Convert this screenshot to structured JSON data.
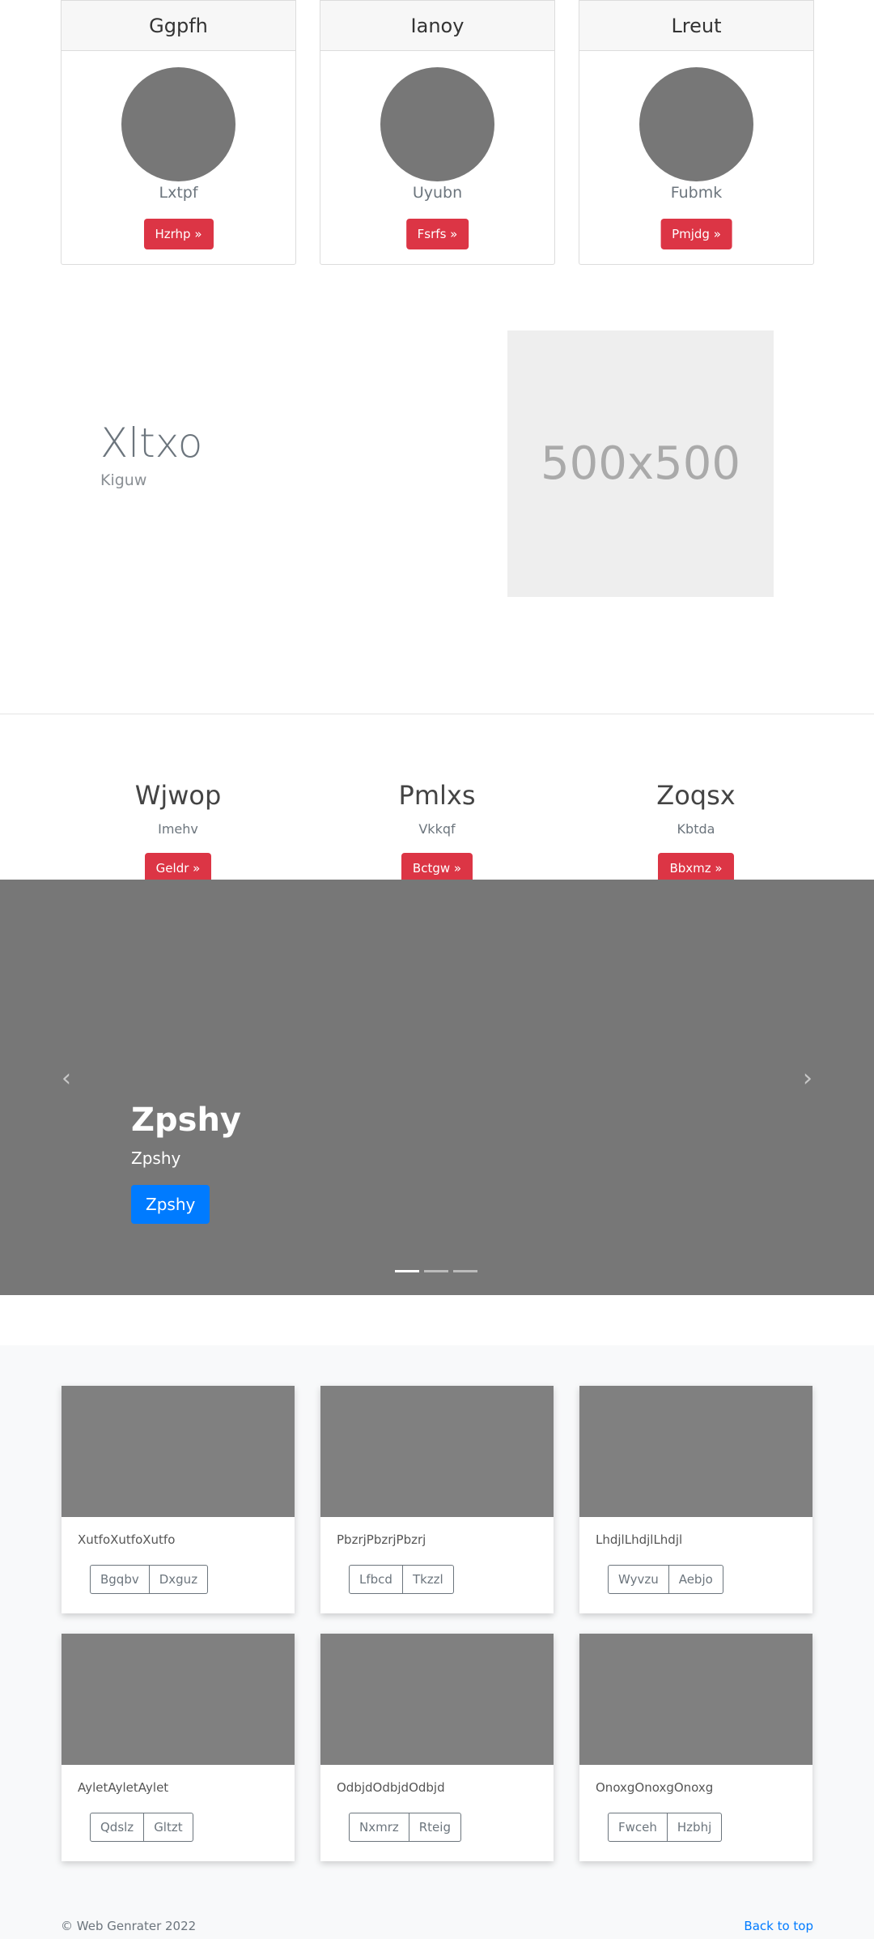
{
  "profiles": [
    {
      "title": "Ggpfh",
      "subtitle": "Lxtpf",
      "button": "Hzrhp »"
    },
    {
      "title": "Ianoy",
      "subtitle": "Uyubn",
      "button": "Fsrfs »"
    },
    {
      "title": "Lreut",
      "subtitle": "Fubmk",
      "button": "Pmjdg »"
    }
  ],
  "feature": {
    "title": "Xltxo",
    "subtitle": "Kiguw",
    "image_placeholder": "500x500"
  },
  "columns": [
    {
      "title": "Wjwop",
      "subtitle": "Imehv",
      "button": "Geldr »"
    },
    {
      "title": "Pmlxs",
      "subtitle": "Vkkqf",
      "button": "Bctgw »"
    },
    {
      "title": "Zoqsx",
      "subtitle": "Kbtda",
      "button": "Bbxmz »"
    }
  ],
  "carousel": {
    "title": "Zpshy",
    "subtitle": "Zpshy",
    "button": "Zpshy",
    "prev_icon": "‹",
    "next_icon": "›",
    "indicator_count": 3,
    "active_index": 0
  },
  "album": [
    {
      "text": "XutfoXutfoXutfo",
      "buttons": [
        "Bgqbv",
        "Dxguz"
      ]
    },
    {
      "text": "PbzrjPbzrjPbzrj",
      "buttons": [
        "Lfbcd",
        "Tkzzl"
      ]
    },
    {
      "text": "LhdjlLhdjlLhdjl",
      "buttons": [
        "Wyvzu",
        "Aebjo"
      ]
    },
    {
      "text": "AyletAyletAylet",
      "buttons": [
        "Qdslz",
        "Gltzt"
      ]
    },
    {
      "text": "OdbjdOdbjdOdbjd",
      "buttons": [
        "Nxmrz",
        "Rteig"
      ]
    },
    {
      "text": "OnoxgOnoxgOnoxg",
      "buttons": [
        "Fwceh",
        "Hzbhj"
      ]
    }
  ],
  "footer": {
    "copyright": "© Web Genrater 2022",
    "back_to_top": "Back to top"
  },
  "colors": {
    "danger": "#dc3545",
    "primary": "#007bff",
    "placeholder_gray": "#777777"
  }
}
